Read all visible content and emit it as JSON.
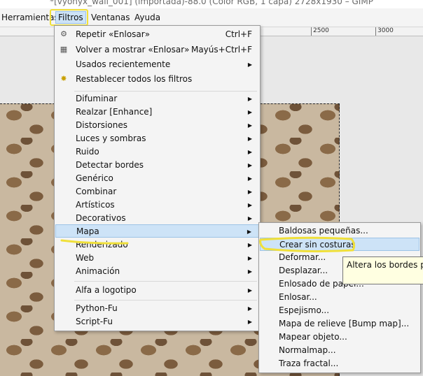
{
  "window": {
    "title": "*[vyonyx_wall_001] (importada)-88.0 (Color RGB, 1 capa) 2728x1930 – GIMP"
  },
  "menubar": {
    "items": [
      "Herramientas",
      "Filtros",
      "Ventanas",
      "Ayuda"
    ]
  },
  "ruler": {
    "labels": [
      "2500",
      "3000"
    ]
  },
  "filters_menu": {
    "repeat": {
      "label": "Repetir «Enlosar»",
      "shortcut": "Ctrl+F"
    },
    "reshow": {
      "label": "Volver a mostrar «Enlosar»",
      "shortcut": "Mayús+Ctrl+F"
    },
    "recent": {
      "label": "Usados recientemente"
    },
    "reset": {
      "label": "Restablecer todos los filtros"
    },
    "items": [
      "Difuminar",
      "Realzar [Enhance]",
      "Distorsiones",
      "Luces y sombras",
      "Ruido",
      "Detectar bordes",
      "Genérico",
      "Combinar",
      "Artísticos",
      "Decorativos",
      "Mapa",
      "Renderizado",
      "Web",
      "Animación"
    ],
    "alpha": {
      "label": "Alfa a logotipo"
    },
    "script_items": [
      "Python-Fu",
      "Script-Fu"
    ]
  },
  "map_submenu": {
    "items": [
      "Baldosas pequeñas...",
      "Crear sin costuras",
      "Deformar...",
      "Desplazar...",
      "Enlosado de papel...",
      "Enlosar...",
      "Espejismo...",
      "Mapa de relieve [Bump map]...",
      "Mapear objeto...",
      "Normalmap...",
      "Traza fractal..."
    ]
  },
  "tooltip": {
    "text": "Altera los bordes para"
  },
  "colors": {
    "highlight_annotation": "#f0e03a",
    "selection_bg": "#cde3f7"
  }
}
